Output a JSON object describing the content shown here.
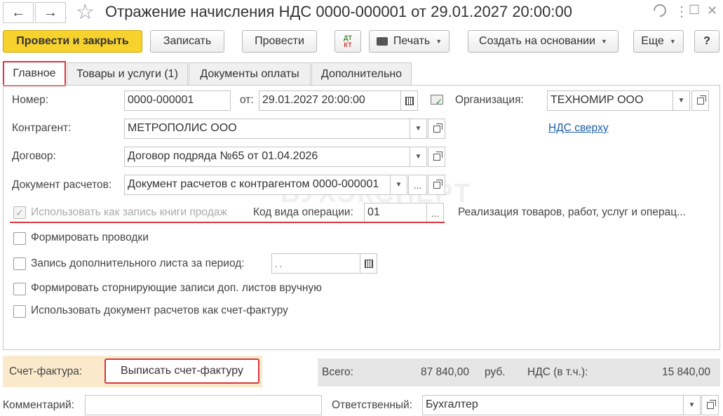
{
  "window": {
    "title": "Отражение начисления НДС 0000-000001 от 29.01.2027 20:00:00",
    "back_icon": "←",
    "forward_icon": "→",
    "star_icon": "☆",
    "link_icon": "🔗",
    "menu_icon": "⋮",
    "maximize_icon": "☐",
    "close_icon": "✕"
  },
  "toolbar": {
    "post_close": "Провести и закрыть",
    "save": "Записать",
    "post": "Провести",
    "dtkt_top": "ДТ",
    "dtkt_bottom": "КТ",
    "print": "Печать",
    "create_based": "Создать на основании",
    "more": "Еще",
    "help": "?"
  },
  "tabs": [
    "Главное",
    "Товары и услуги (1)",
    "Документы оплаты",
    "Дополнительно"
  ],
  "form": {
    "number_label": "Номер:",
    "number_value": "0000-000001",
    "date_label": "от:",
    "date_value": "29.01.2027 20:00:00",
    "org_label": "Организация:",
    "org_value": "ТЕХНОМИР ООО",
    "contractor_label": "Контрагент:",
    "contractor_value": "МЕТРОПОЛИС ООО",
    "vat_link": "НДС сверху",
    "contract_label": "Договор:",
    "contract_value": "Договор подряда №65 от 01.04.2026",
    "settlement_label": "Документ расчетов:",
    "settlement_value": "Документ расчетов с контрагентом 0000-000001",
    "sales_book_label": "Использовать как запись книги продаж",
    "op_code_label": "Код вида операции:",
    "op_code_value": "01",
    "op_code_desc": "Реализация товаров, работ, услуг и операц...",
    "make_entries": "Формировать проводки",
    "extra_sheet": "Запись дополнительного листа за период:",
    "extra_sheet_value": " .  .",
    "storno": "Формировать сторнирующие записи доп. листов вручную",
    "use_as_invoice": "Использовать документ расчетов как счет-фактуру"
  },
  "footer": {
    "invoice_label": "Счет-фактура:",
    "invoice_button": "Выписать счет-фактуру",
    "total_label": "Всего:",
    "total_value": "87 840,00",
    "currency": "руб.",
    "vat_label": "НДС (в т.ч.):",
    "vat_value": "15 840,00",
    "comment_label": "Комментарий:",
    "comment_value": "",
    "responsible_label": "Ответственный:",
    "responsible_value": "Бухгалтер"
  },
  "watermark": "БУХЭКСПЕРТ",
  "colors": {
    "primary": "#f7d12c",
    "highlight": "#d9363e",
    "link": "#1a5fa8",
    "footer_bg": "#faeacb"
  }
}
